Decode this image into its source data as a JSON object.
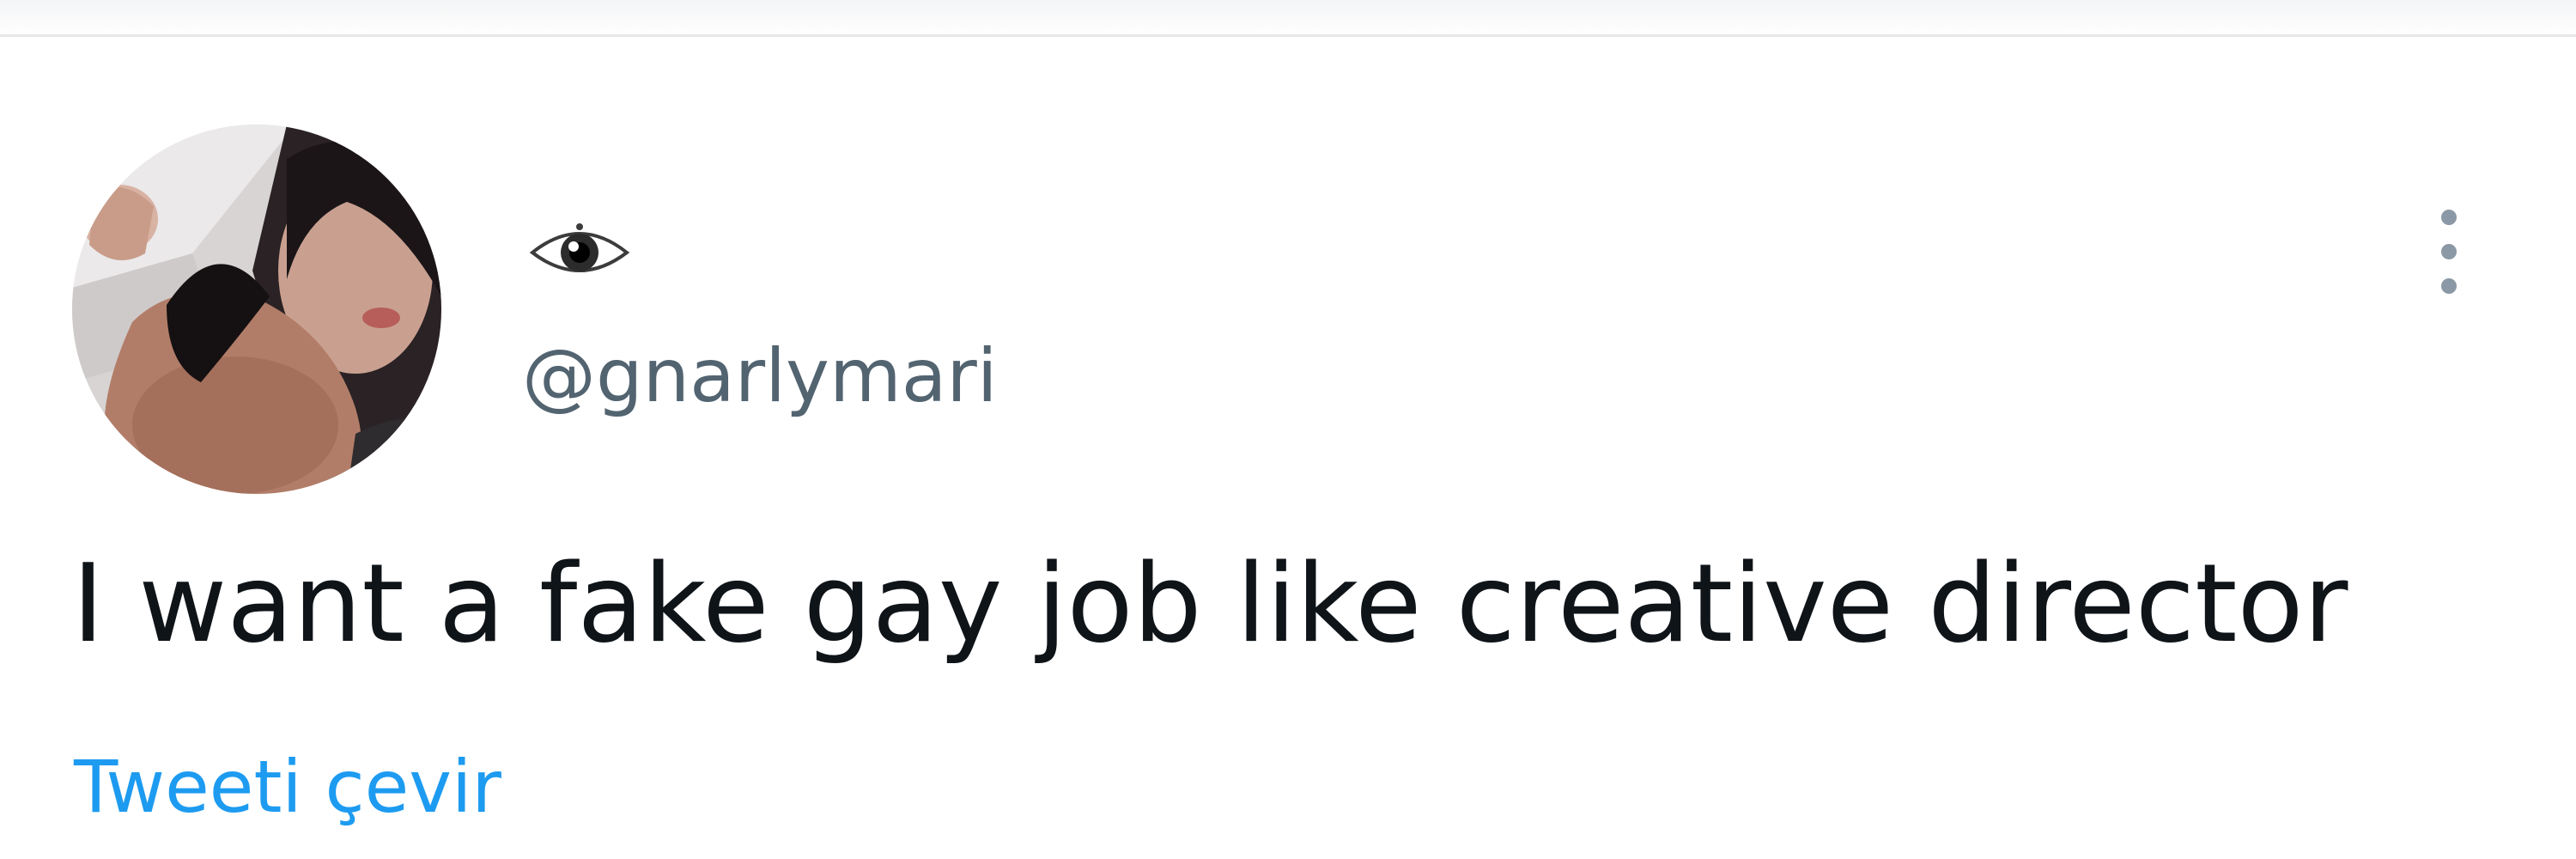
{
  "user": {
    "display_name_icon": "eye-icon",
    "handle": "@gnarlymari",
    "avatar": "profile-photo"
  },
  "tweet": {
    "text": "I want a fake gay job like creative director",
    "translate_label": "Tweeti çevir",
    "more_icon": "more-vertical-icon"
  },
  "colors": {
    "text_primary": "#0f1419",
    "text_secondary": "#536471",
    "link": "#1d9bf0"
  }
}
